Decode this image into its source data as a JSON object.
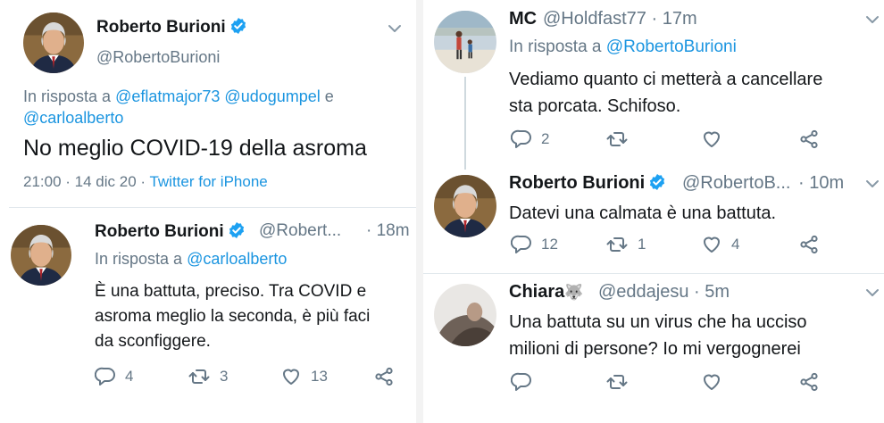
{
  "left": {
    "main_tweet": {
      "name": "Roberto Burioni",
      "handle": "@RobertoBurioni",
      "reply_prefix": "In risposta a",
      "reply_to_1": "@eflatmajor73",
      "reply_to_2": "@udogumpel",
      "reply_and": "e",
      "reply_to_3": "@carloalberto",
      "text": "No meglio COVID-19 della asroma",
      "time": "21:00 · 14 dic 20 · ",
      "source": "Twitter for iPhone"
    },
    "reply_tweet": {
      "name": "Roberto Burioni",
      "handle": "@Robert...",
      "time": "· 18m",
      "reply_prefix": "In risposta a",
      "reply_to": "@carloalberto",
      "line1": "È una battuta, preciso. Tra COVID e",
      "line2": "asroma meglio la seconda, è più faci",
      "line3": "da sconfiggere.",
      "replies": "4",
      "retweets": "3",
      "likes": "13"
    }
  },
  "right": {
    "tweet1": {
      "name": "MC",
      "handle": "@Holdfast77 · 17m",
      "reply_prefix": "In risposta a",
      "reply_to": "@RobertoBurioni",
      "line1": "Vediamo quanto ci metterà a cancellare",
      "line2": "sta porcata. Schifoso.",
      "replies": "2"
    },
    "tweet2": {
      "name": "Roberto Burioni",
      "handle": "@RobertoB...",
      "time": "· 10m",
      "line1": "Datevi una calmata è una battuta.",
      "replies": "12",
      "retweets": "1",
      "likes": "4"
    },
    "tweet3": {
      "name": "Chiara",
      "emoji": "🐺",
      "handle": "@eddajesu · 5m",
      "line1": "Una battuta su un virus che ha ucciso",
      "line2": "milioni di persone? Io mi vergognerei"
    }
  },
  "colors": {
    "link": "#1b95e0",
    "muted": "#657786",
    "text": "#14171a",
    "separator": "#e1e8ed"
  },
  "icons": [
    "verified-badge-icon",
    "chevron-down-icon",
    "reply-icon",
    "retweet-icon",
    "like-icon",
    "share-icon"
  ]
}
